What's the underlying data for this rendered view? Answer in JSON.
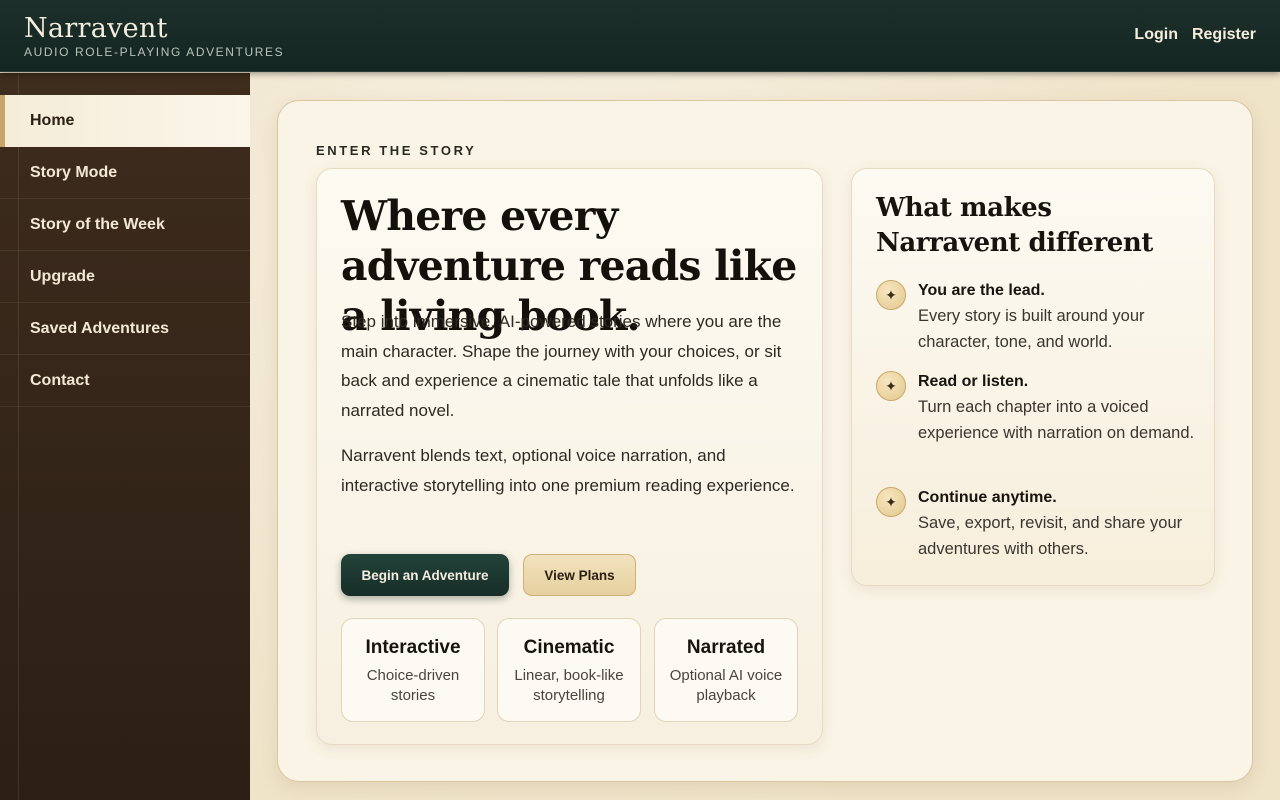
{
  "header": {
    "brand_name": "Narravent",
    "brand_tagline": "AUDIO ROLE-PLAYING ADVENTURES",
    "login_label": "Login",
    "register_label": "Register"
  },
  "sidebar": {
    "items": [
      {
        "label": "Home",
        "active": true
      },
      {
        "label": "Story Mode"
      },
      {
        "label": "Story of the Week"
      },
      {
        "label": "Upgrade"
      },
      {
        "label": "Saved Adventures"
      },
      {
        "label": "Contact"
      }
    ]
  },
  "main": {
    "eyebrow": "ENTER THE STORY",
    "hero": {
      "title": "Where every adventure reads like a living book.",
      "paragraph1": "Step into immersive, AI-powered stories where you are the main character. Shape the journey with your choices, or sit back and experience a cinematic tale that unfolds like a narrated novel.",
      "paragraph2": "Narravent blends text, optional voice narration, and interactive storytelling into one premium reading experience.",
      "primary_button": "Begin an Adventure",
      "secondary_button": "View Plans",
      "modes": [
        {
          "title": "Interactive",
          "desc": "Choice-driven stories"
        },
        {
          "title": "Cinematic",
          "desc": "Linear, book-like storytelling"
        },
        {
          "title": "Narrated",
          "desc": "Optional AI voice playback"
        }
      ]
    },
    "features": {
      "title": "What makes Narravent different",
      "icon": "sparkle-icon",
      "icon_glyph": "✦",
      "items": [
        {
          "head": "You are the lead.",
          "text": "Every story is built around your character, tone, and world."
        },
        {
          "head": "Read or listen.",
          "text": "Turn each chapter into a voiced experience with narration on demand."
        },
        {
          "head": "Continue anytime.",
          "text": "Save, export, revisit, and share your adventures with others."
        }
      ]
    }
  },
  "colors": {
    "header_bg": "#142622",
    "sidebar_bg": "#2b1f15",
    "accent_gold": "#c9a46a",
    "primary_button": "#172e28",
    "panel_bg": "#faf4e6"
  }
}
